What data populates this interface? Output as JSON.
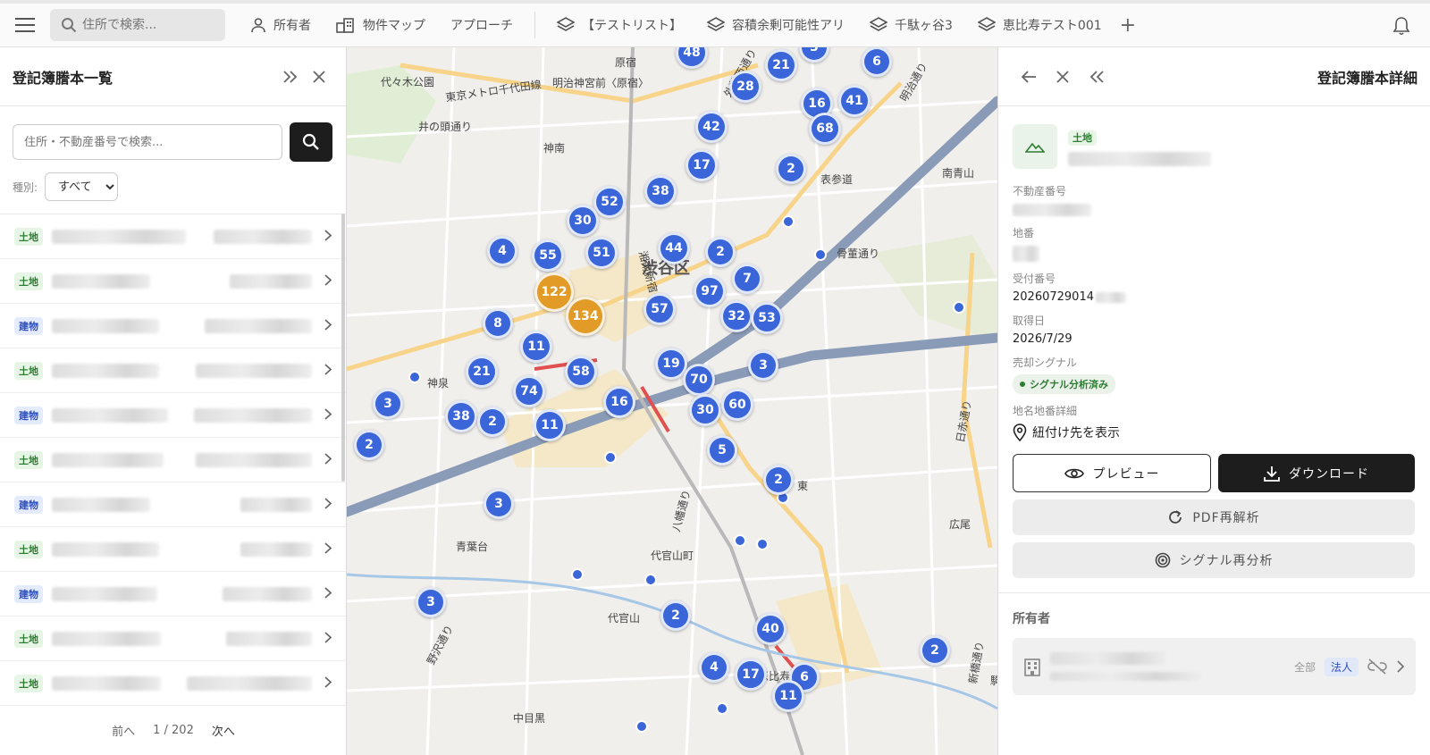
{
  "topbar": {
    "search_placeholder": "住所で検索...",
    "nav": [
      {
        "label": "所有者",
        "icon": "person-icon"
      },
      {
        "label": "物件マップ",
        "icon": "building-map-icon"
      },
      {
        "label": "アプローチ",
        "icon": ""
      }
    ],
    "lists": [
      {
        "label": "【テストリスト】",
        "icon": "layers-icon"
      },
      {
        "label": "容積余剰可能性アリ",
        "icon": "layers-icon"
      },
      {
        "label": "千駄ヶ谷3",
        "icon": "layers-icon"
      },
      {
        "label": "恵比寿テスト001",
        "icon": "layers-icon"
      }
    ],
    "add_label": "+"
  },
  "left_panel": {
    "title": "登記簿謄本一覧",
    "search_placeholder": "住所・不動産番号で検索...",
    "filter_label": "種別:",
    "filter_value": "すべて",
    "rows": [
      {
        "type": "土地"
      },
      {
        "type": "土地"
      },
      {
        "type": "建物"
      },
      {
        "type": "土地"
      },
      {
        "type": "建物"
      },
      {
        "type": "土地"
      },
      {
        "type": "建物"
      },
      {
        "type": "土地"
      },
      {
        "type": "建物"
      },
      {
        "type": "土地"
      },
      {
        "type": "土地"
      }
    ],
    "pager": {
      "prev": "前へ",
      "page": "1 / 202",
      "next": "次へ"
    }
  },
  "map": {
    "labels": [
      {
        "text": "原宿"
      },
      {
        "text": "代々木公園"
      },
      {
        "text": "明治神宮前〈原宿〉"
      },
      {
        "text": "神南"
      },
      {
        "text": "渋谷区"
      },
      {
        "text": "井の頭通り"
      },
      {
        "text": "表参道"
      },
      {
        "text": "南青山"
      },
      {
        "text": "骨董通り"
      },
      {
        "text": "神泉"
      },
      {
        "text": "青葉台"
      },
      {
        "text": "代官山町"
      },
      {
        "text": "代官山"
      },
      {
        "text": "恵比寿"
      },
      {
        "text": "東"
      },
      {
        "text": "広尾"
      },
      {
        "text": "中目黒"
      },
      {
        "text": "野沢通り"
      },
      {
        "text": "八幡通り"
      },
      {
        "text": "明治通り"
      },
      {
        "text": "日赤通り"
      },
      {
        "text": "新橋通り"
      },
      {
        "text": "駒沢通り"
      },
      {
        "text": "湘南新宿ライン"
      },
      {
        "text": "東京メトロ千代田線"
      },
      {
        "text": "外苑西通り"
      }
    ],
    "clusters": [
      {
        "value": "48",
        "big": false
      },
      {
        "value": "3",
        "big": false
      },
      {
        "value": "21",
        "big": false
      },
      {
        "value": "6",
        "big": false
      },
      {
        "value": "28",
        "big": false
      },
      {
        "value": "16",
        "big": false
      },
      {
        "value": "41",
        "big": false
      },
      {
        "value": "42",
        "big": false
      },
      {
        "value": "68",
        "big": false
      },
      {
        "value": "17",
        "big": false
      },
      {
        "value": "2",
        "big": false
      },
      {
        "value": "38",
        "big": false
      },
      {
        "value": "52",
        "big": false
      },
      {
        "value": "30",
        "big": false
      },
      {
        "value": "44",
        "big": false
      },
      {
        "value": "4",
        "big": false
      },
      {
        "value": "55",
        "big": false
      },
      {
        "value": "51",
        "big": false
      },
      {
        "value": "2",
        "big": false
      },
      {
        "value": "7",
        "big": false
      },
      {
        "value": "122",
        "big": true
      },
      {
        "value": "134",
        "big": true
      },
      {
        "value": "97",
        "big": false
      },
      {
        "value": "57",
        "big": false
      },
      {
        "value": "32",
        "big": false
      },
      {
        "value": "53",
        "big": false
      },
      {
        "value": "8",
        "big": false
      },
      {
        "value": "11",
        "big": false
      },
      {
        "value": "19",
        "big": false
      },
      {
        "value": "3",
        "big": false
      },
      {
        "value": "58",
        "big": false
      },
      {
        "value": "70",
        "big": false
      },
      {
        "value": "21",
        "big": false
      },
      {
        "value": "74",
        "big": false
      },
      {
        "value": "16",
        "big": false
      },
      {
        "value": "30",
        "big": false
      },
      {
        "value": "60",
        "big": false
      },
      {
        "value": "3",
        "big": false
      },
      {
        "value": "38",
        "big": false
      },
      {
        "value": "2",
        "big": false
      },
      {
        "value": "11",
        "big": false
      },
      {
        "value": "2",
        "big": false
      },
      {
        "value": "5",
        "big": false
      },
      {
        "value": "2",
        "big": false
      },
      {
        "value": "3",
        "big": false
      },
      {
        "value": "3",
        "big": false
      },
      {
        "value": "2",
        "big": false
      },
      {
        "value": "40",
        "big": false
      },
      {
        "value": "4",
        "big": false
      },
      {
        "value": "17",
        "big": false
      },
      {
        "value": "6",
        "big": false
      },
      {
        "value": "11",
        "big": false
      },
      {
        "value": "2",
        "big": false
      }
    ]
  },
  "right_panel": {
    "title": "登記簿謄本詳細",
    "type_badge": "土地",
    "fields": {
      "real_estate_number_label": "不動産番号",
      "lot_number_label": "地番",
      "receipt_number_label": "受付番号",
      "receipt_number_value": "20260729014",
      "acquisition_date_label": "取得日",
      "acquisition_date_value": "2026/7/29",
      "sale_signal_label": "売却シグナル",
      "sale_signal_value": "シグナル分析済み",
      "address_detail_label": "地名地番詳細",
      "address_link_label": "紐付け先を表示"
    },
    "buttons": {
      "preview": "プレビュー",
      "download": "ダウンロード",
      "pdf_reparse": "PDF再解析",
      "signal_reanalyze": "シグナル再分析"
    },
    "owner": {
      "section_label": "所有者",
      "tag_all": "全部",
      "tag_corp": "法人"
    }
  },
  "colors": {
    "cluster_blue": "#3b66d9",
    "cluster_orange": "#e19b26",
    "land_badge": "#2e7d32",
    "building_badge": "#2d4fbf",
    "dark_button": "#1d1d1d"
  }
}
